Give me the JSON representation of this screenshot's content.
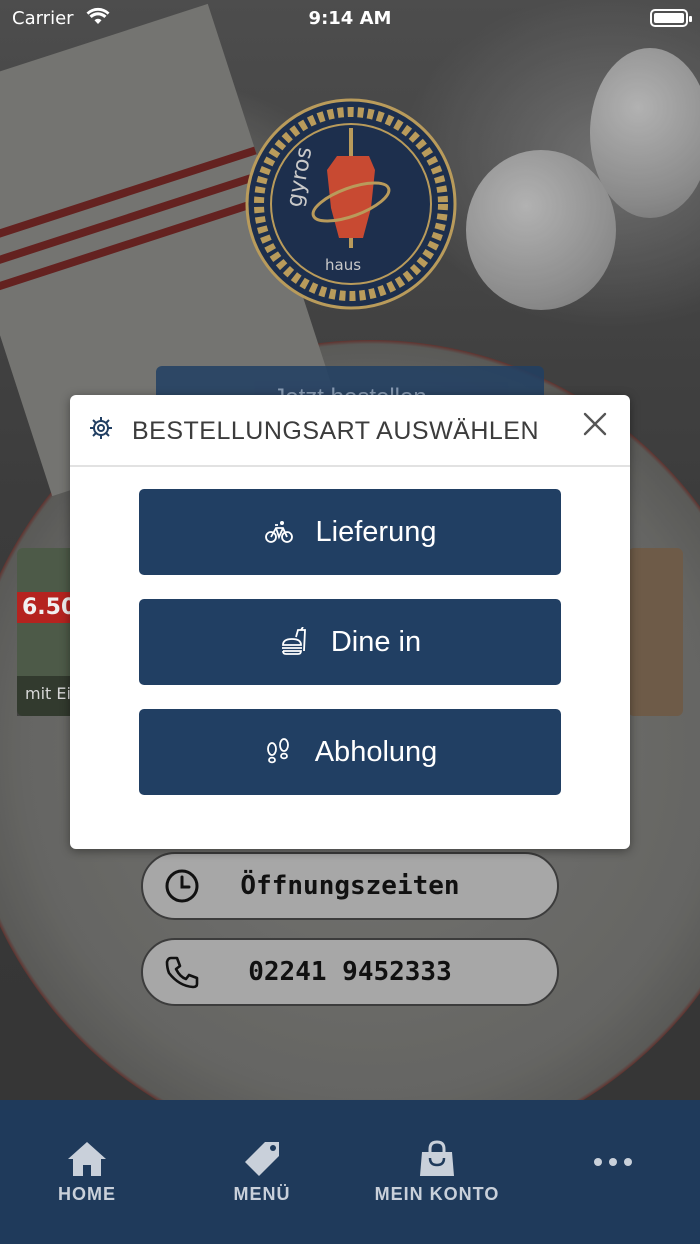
{
  "status_bar": {
    "carrier": "Carrier",
    "time": "9:14 AM"
  },
  "logo": {
    "top_text": "gyros",
    "bottom_text": "haus"
  },
  "background": {
    "order_now_label": "Jetzt bestellen",
    "card_price": "6.50",
    "card_caption": "mit Eis"
  },
  "info": {
    "opening_hours_label": "Öffnungszeiten",
    "phone_label": "02241 9452333"
  },
  "modal": {
    "title": "BESTELLUNGSART AUSWÄHLEN",
    "options": [
      {
        "label": "Lieferung",
        "icon": "bicycle-icon"
      },
      {
        "label": "Dine in",
        "icon": "fastfood-icon"
      },
      {
        "label": "Abholung",
        "icon": "footsteps-icon"
      }
    ]
  },
  "tabbar": {
    "tabs": [
      {
        "label": "HOME",
        "icon": "home-icon"
      },
      {
        "label": "MENÜ",
        "icon": "tag-icon"
      },
      {
        "label": "MEIN KONTO",
        "icon": "shopping-bag-icon"
      },
      {
        "label": "",
        "icon": "more-icon"
      }
    ]
  },
  "colors": {
    "primary_navy": "#213f63",
    "tabbar_navy": "#1f3a5b",
    "logo_red": "#c84a32",
    "logo_gold": "#b99b5b",
    "price_red": "#b5231f"
  }
}
